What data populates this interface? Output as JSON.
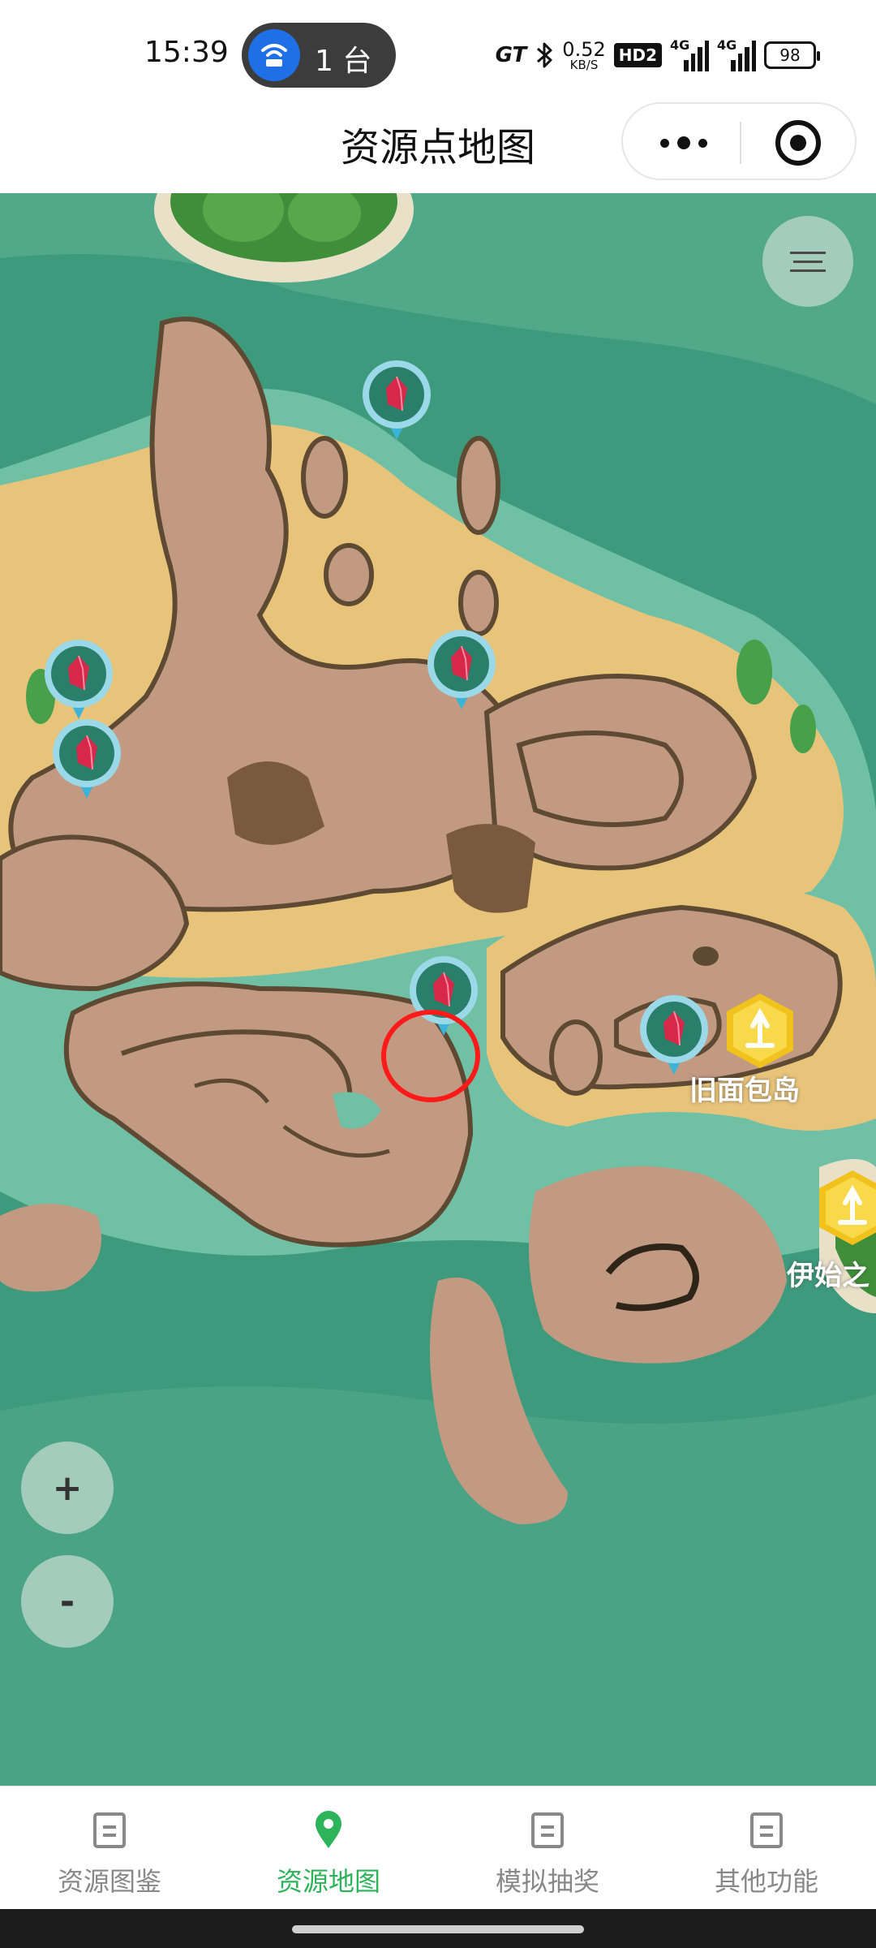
{
  "status_bar": {
    "time": "15:39",
    "hotspot_label": "1 台",
    "network_brand": "GT",
    "speed_value": "0.52",
    "speed_unit": "KB/S",
    "hd_badge": "HD2",
    "signal1_label": "4G",
    "signal2_label": "4G",
    "battery": "98"
  },
  "nav": {
    "title": "资源点地图"
  },
  "map": {
    "place_labels": [
      "旧面包岛",
      "伊始之"
    ],
    "zoom_in_label": "+",
    "zoom_out_label": "-"
  },
  "tabs": [
    {
      "label": "资源图鉴",
      "icon": "document-icon",
      "active": false
    },
    {
      "label": "资源地图",
      "icon": "location-pin-icon",
      "active": true
    },
    {
      "label": "模拟抽奖",
      "icon": "document-icon",
      "active": false
    },
    {
      "label": "其他功能",
      "icon": "document-icon",
      "active": false
    }
  ],
  "colors": {
    "accent": "#2db35a",
    "tab_inactive": "#888888",
    "selection_ring": "#ff1a1a",
    "water": "#3e9a7c",
    "sand": "#e8c47a",
    "rock": "#c29a82"
  }
}
